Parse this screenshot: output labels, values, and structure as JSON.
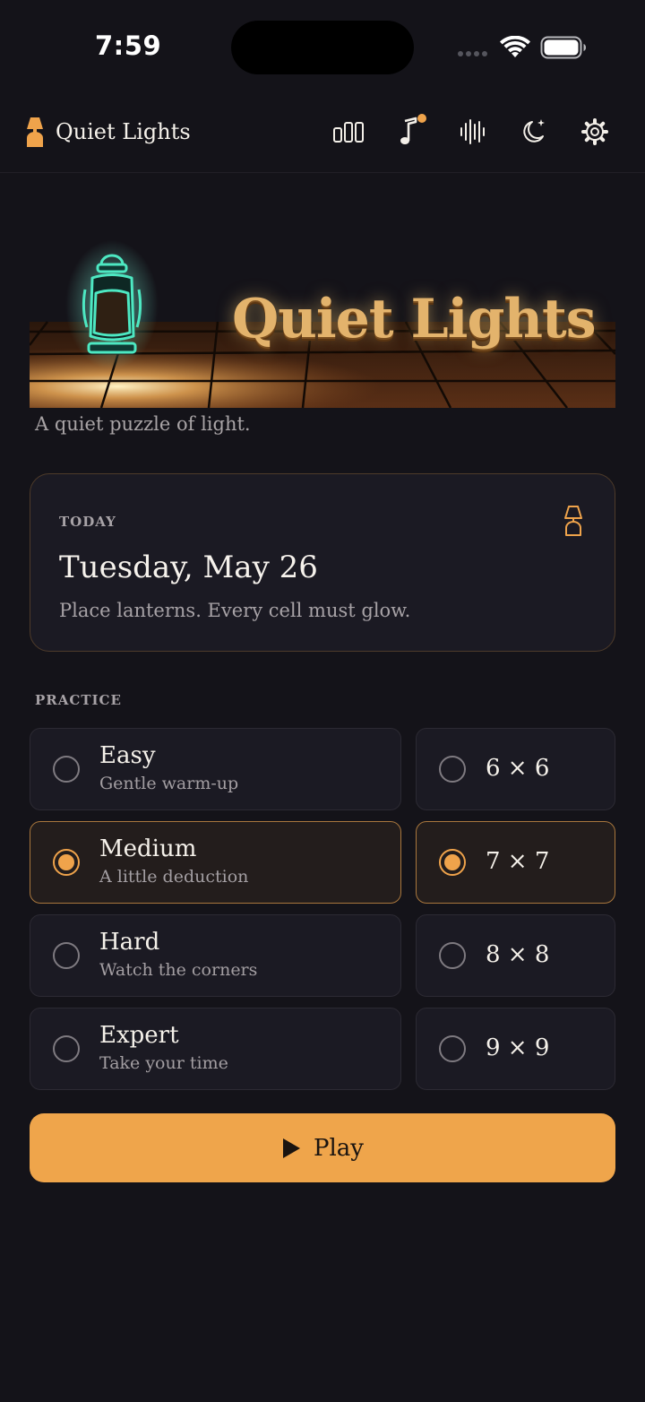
{
  "status_bar": {
    "time": "7:59"
  },
  "header": {
    "app_name": "Quiet Lights",
    "icons": [
      "bar-chart-icon",
      "music-note-icon",
      "sound-waves-icon",
      "moon-stars-icon",
      "gear-icon"
    ],
    "notification_dot_color": "#efa34b"
  },
  "hero": {
    "title": "Quiet Lights",
    "tagline": "A quiet puzzle of light."
  },
  "today": {
    "label": "TODAY",
    "date": "Tuesday, May 26",
    "description": "Place lanterns. Every cell must glow.",
    "icon": "lamp-icon"
  },
  "practice": {
    "label": "PRACTICE",
    "difficulties": [
      {
        "title": "Easy",
        "subtitle": "Gentle warm-up",
        "selected": false
      },
      {
        "title": "Medium",
        "subtitle": "A little deduction",
        "selected": true
      },
      {
        "title": "Hard",
        "subtitle": "Watch the corners",
        "selected": false
      },
      {
        "title": "Expert",
        "subtitle": "Take your time",
        "selected": false
      }
    ],
    "sizes": [
      {
        "label": "6 × 6",
        "selected": false
      },
      {
        "label": "7 × 7",
        "selected": true
      },
      {
        "label": "8 × 8",
        "selected": false
      },
      {
        "label": "9 × 9",
        "selected": false
      }
    ]
  },
  "play_button": {
    "label": "Play"
  },
  "colors": {
    "background": "#141319",
    "card": "#1b1a23",
    "accent": "#efa54b",
    "selected_border": "#a9773d"
  }
}
